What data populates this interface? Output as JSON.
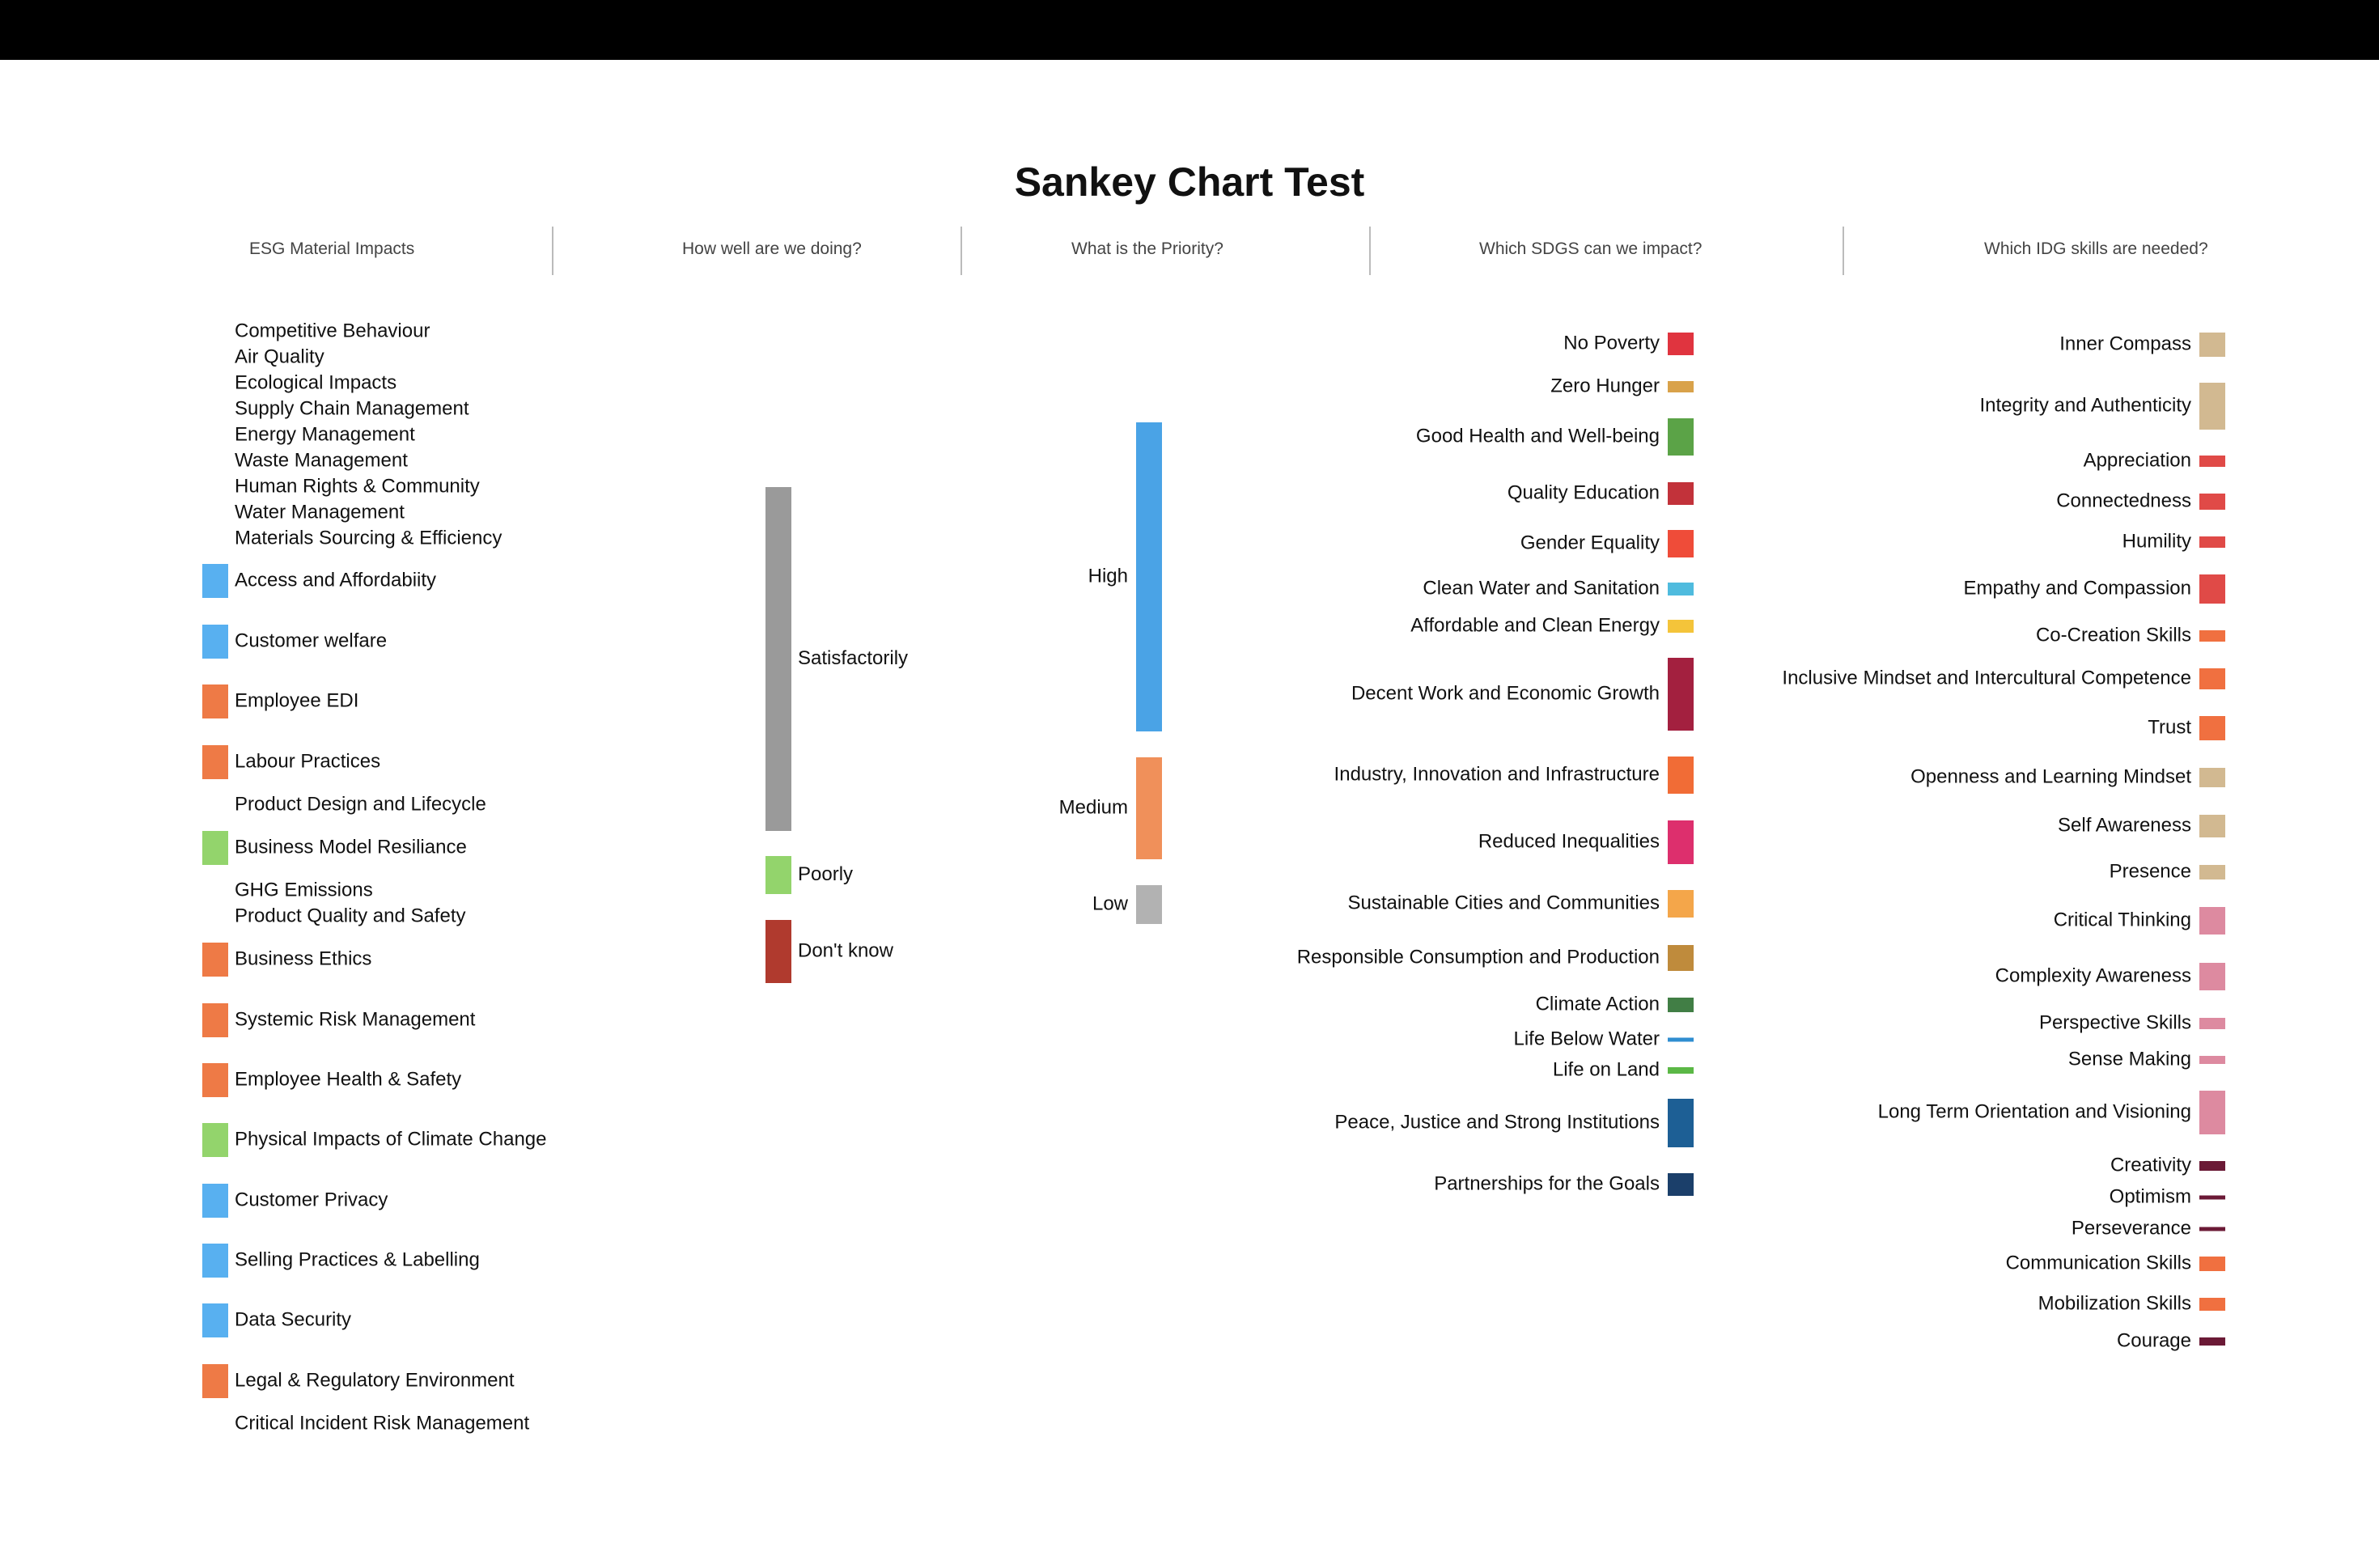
{
  "title": "Sankey Chart Test",
  "headers": [
    "ESG Material Impacts",
    "How well are we doing?",
    "What is the Priority?",
    "Which SDGS can we impact?",
    "Which IDG skills are needed?"
  ],
  "colors": {
    "blue": "#58b0f0",
    "orange": "#ee7a46",
    "green": "#93d46c",
    "grey": "#9a9a9a",
    "darkred": "#b03a2e"
  },
  "chart_data": {
    "type": "sankey",
    "title": "Sankey Chart Test",
    "columns": [
      "ESG Material Impacts",
      "How well are we doing?",
      "What is the Priority?",
      "Which SDGS can we impact?",
      "Which IDG skills are needed?"
    ],
    "esg_impacts": [
      {
        "name": "Competitive Behaviour",
        "value": 0,
        "color": ""
      },
      {
        "name": "Air Quality",
        "value": 0,
        "color": ""
      },
      {
        "name": "Ecological Impacts",
        "value": 0,
        "color": ""
      },
      {
        "name": "Supply Chain Management",
        "value": 0,
        "color": ""
      },
      {
        "name": "Energy Management",
        "value": 0,
        "color": ""
      },
      {
        "name": "Waste Management",
        "value": 0,
        "color": ""
      },
      {
        "name": "Human Rights & Community",
        "value": 0,
        "color": ""
      },
      {
        "name": "Water Management",
        "value": 0,
        "color": ""
      },
      {
        "name": "Materials Sourcing & Efficiency",
        "value": 0,
        "color": ""
      },
      {
        "name": "Access and Affordabiity",
        "value": 1,
        "color": "#58b0f0"
      },
      {
        "name": "Customer welfare",
        "value": 1,
        "color": "#58b0f0"
      },
      {
        "name": "Employee EDI",
        "value": 1,
        "color": "#ee7a46"
      },
      {
        "name": "Labour Practices",
        "value": 1,
        "color": "#ee7a46"
      },
      {
        "name": "Product Design and Lifecycle",
        "value": 0,
        "color": ""
      },
      {
        "name": "Business Model Resiliance",
        "value": 1,
        "color": "#93d46c"
      },
      {
        "name": "GHG Emissions",
        "value": 0,
        "color": ""
      },
      {
        "name": "Product Quality and Safety",
        "value": 0,
        "color": ""
      },
      {
        "name": "Business Ethics",
        "value": 1,
        "color": "#ee7a46"
      },
      {
        "name": "Systemic Risk Management",
        "value": 1,
        "color": "#ee7a46"
      },
      {
        "name": "Employee Health & Safety",
        "value": 1,
        "color": "#ee7a46"
      },
      {
        "name": "Physical Impacts of Climate Change",
        "value": 1,
        "color": "#93d46c"
      },
      {
        "name": "Customer Privacy",
        "value": 1,
        "color": "#58b0f0"
      },
      {
        "name": "Selling Practices & Labelling",
        "value": 1,
        "color": "#58b0f0"
      },
      {
        "name": "Data Security",
        "value": 1,
        "color": "#58b0f0"
      },
      {
        "name": "Legal & Regulatory Environment",
        "value": 1,
        "color": "#ee7a46"
      },
      {
        "name": "Critical Incident Risk Management",
        "value": 0,
        "color": ""
      }
    ],
    "performance": [
      {
        "name": "Satisfactorily",
        "value": 10,
        "color": "#9a9a9a"
      },
      {
        "name": "Poorly",
        "value": 1,
        "color": "#93d46c"
      },
      {
        "name": "Don't know",
        "value": 2,
        "color": "#b03a2e"
      }
    ],
    "priority": [
      {
        "name": "High",
        "value": 8,
        "color": "#4aa3e6"
      },
      {
        "name": "Medium",
        "value": 3,
        "color": "#f0905a"
      },
      {
        "name": "Low",
        "value": 1,
        "color": "#b2b2b2"
      }
    ],
    "sdgs": [
      {
        "name": "No Poverty",
        "value": 1,
        "color": "#e0343f"
      },
      {
        "name": "Zero Hunger",
        "value": 0.5,
        "color": "#d9a24a"
      },
      {
        "name": "Good Health and Well-being",
        "value": 1.5,
        "color": "#5ba347"
      },
      {
        "name": "Quality Education",
        "value": 1,
        "color": "#c2323a"
      },
      {
        "name": "Gender Equality",
        "value": 1,
        "color": "#ef4c39"
      },
      {
        "name": "Clean Water and Sanitation",
        "value": 0.5,
        "color": "#4fbbde"
      },
      {
        "name": "Affordable and Clean Energy",
        "value": 0.5,
        "color": "#f4c43a"
      },
      {
        "name": "Decent Work and Economic Growth",
        "value": 3,
        "color": "#a3203f"
      },
      {
        "name": "Industry, Innovation and Infrastructure",
        "value": 1.5,
        "color": "#f16c36"
      },
      {
        "name": "Reduced Inequalities",
        "value": 2,
        "color": "#dd2f6d"
      },
      {
        "name": "Sustainable Cities and Communities",
        "value": 1,
        "color": "#f4a64a"
      },
      {
        "name": "Responsible Consumption and Production",
        "value": 1,
        "color": "#bf8b3c"
      },
      {
        "name": "Climate Action",
        "value": 0.5,
        "color": "#417e45"
      },
      {
        "name": "Life Below Water",
        "value": 0.15,
        "color": "#2f8ed0"
      },
      {
        "name": "Life on Land",
        "value": 0.2,
        "color": "#5bb846"
      },
      {
        "name": "Peace, Justice and Strong Institutions",
        "value": 2,
        "color": "#1d5f95"
      },
      {
        "name": "Partnerships for the Goals",
        "value": 1,
        "color": "#1b3f6a"
      }
    ],
    "idg_skills": [
      {
        "name": "Inner Compass",
        "value": 1,
        "color": "#d2b991"
      },
      {
        "name": "Integrity and Authenticity",
        "value": 2,
        "color": "#d2b991"
      },
      {
        "name": "Appreciation",
        "value": 0.5,
        "color": "#e04a47"
      },
      {
        "name": "Connectedness",
        "value": 0.7,
        "color": "#e04a47"
      },
      {
        "name": "Humility",
        "value": 0.5,
        "color": "#e04a47"
      },
      {
        "name": "Empathy and Compassion",
        "value": 1.2,
        "color": "#e04a47"
      },
      {
        "name": "Co-Creation Skills",
        "value": 0.5,
        "color": "#f07040"
      },
      {
        "name": "Inclusive Mindset and Intercultural Competence",
        "value": 0.8,
        "color": "#f07040"
      },
      {
        "name": "Trust",
        "value": 1,
        "color": "#f07040"
      },
      {
        "name": "Openness and Learning Mindset",
        "value": 0.8,
        "color": "#d2b991"
      },
      {
        "name": "Self Awareness",
        "value": 1,
        "color": "#d2b991"
      },
      {
        "name": "Presence",
        "value": 0.6,
        "color": "#d2b991"
      },
      {
        "name": "Critical Thinking",
        "value": 1.2,
        "color": "#dd8aa0"
      },
      {
        "name": "Complexity Awareness",
        "value": 1.2,
        "color": "#dd8aa0"
      },
      {
        "name": "Perspective Skills",
        "value": 0.5,
        "color": "#dd8aa0"
      },
      {
        "name": "Sense Making",
        "value": 0.4,
        "color": "#dd8aa0"
      },
      {
        "name": "Long Term Orientation and Visioning",
        "value": 1.8,
        "color": "#dd8aa0"
      },
      {
        "name": "Creativity",
        "value": 0.3,
        "color": "#6b1a36"
      },
      {
        "name": "Optimism",
        "value": 0.15,
        "color": "#6b1a36"
      },
      {
        "name": "Perseverance",
        "value": 0.15,
        "color": "#6b1a36"
      },
      {
        "name": "Communication Skills",
        "value": 0.5,
        "color": "#f07040"
      },
      {
        "name": "Mobilization Skills",
        "value": 0.5,
        "color": "#f07040"
      },
      {
        "name": "Courage",
        "value": 0.3,
        "color": "#6b1a36"
      }
    ]
  }
}
